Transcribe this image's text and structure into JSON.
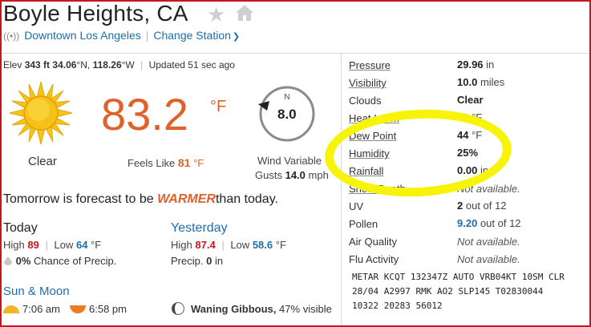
{
  "header": {
    "title": "Boyle Heights, CA",
    "station_label": "Downtown Los Angeles",
    "change_station_label": "Change Station"
  },
  "meta": {
    "elev_label": "Elev",
    "elev_value": "343 ft",
    "lat": "34.06",
    "lat_dir": "°N,",
    "lon": "118.26",
    "lon_dir": "°W",
    "updated": "Updated 51 sec ago"
  },
  "current": {
    "temp": "83.2",
    "unit": "°F",
    "condition": "Clear",
    "feels_label": "Feels Like",
    "feels_value": "81",
    "feels_unit": "°F",
    "wind_value": "8.0",
    "compass_n": "N",
    "wind_variable": "Wind Variable",
    "gusts_label": "Gusts",
    "gusts_value": "14.0",
    "gusts_unit": "mph"
  },
  "forecast": {
    "prefix": "Tomorrow is forecast to be",
    "word": "WARMER",
    "suffix": "than today."
  },
  "today": {
    "heading": "Today",
    "high_label": "High",
    "high": "89",
    "low_label": "Low",
    "low": "64",
    "unit": "°F",
    "precip_pct": "0%",
    "precip_label": "Chance of Precip."
  },
  "yesterday": {
    "heading": "Yesterday",
    "high_label": "High",
    "high": "87.4",
    "low_label": "Low",
    "low": "58.6",
    "unit": "°F",
    "precip_label": "Precip.",
    "precip_value": "0",
    "precip_unit": "in"
  },
  "sun_moon": {
    "heading": "Sun & Moon",
    "sunrise": "7:06 am",
    "sunset": "6:58 pm",
    "moon_phase": "Waning Gibbous,",
    "moon_pct": "47%",
    "moon_visible": "visible"
  },
  "conditions": [
    {
      "label": "Pressure",
      "value": "29.96",
      "unit": "in"
    },
    {
      "label": "Visibility",
      "value": "10.0",
      "unit": "miles"
    },
    {
      "label": "Clouds",
      "value": "Clear",
      "unit": ""
    },
    {
      "label": "Heat Index",
      "value": "81",
      "unit": "°F"
    },
    {
      "label": "Dew Point",
      "value": "44",
      "unit": "°F"
    },
    {
      "label": "Humidity",
      "value": "25%",
      "unit": ""
    },
    {
      "label": "Rainfall",
      "value": "0.00",
      "unit": "in"
    },
    {
      "label": "Snow Depth",
      "value": "Not available.",
      "unit": ""
    },
    {
      "label": "UV",
      "value": "2",
      "unit": "out of 12"
    },
    {
      "label": "Pollen",
      "value": "9.20",
      "unit": "out of 12"
    },
    {
      "label": "Air Quality",
      "value": "Not available.",
      "unit": ""
    },
    {
      "label": "Flu Activity",
      "value": "Not available.",
      "unit": ""
    }
  ],
  "metar": [
    "METAR KCQT 132347Z AUTO VRB04KT 10SM CLR",
    "28/04 A2997 RMK AO2 SLP145 T02830044",
    "10322 20283 56012"
  ],
  "colors": {
    "accent_orange": "#e0622a",
    "link_blue": "#1e6ea9",
    "highlight_yellow": "#f7f40a",
    "frame_red": "#c8161d"
  }
}
